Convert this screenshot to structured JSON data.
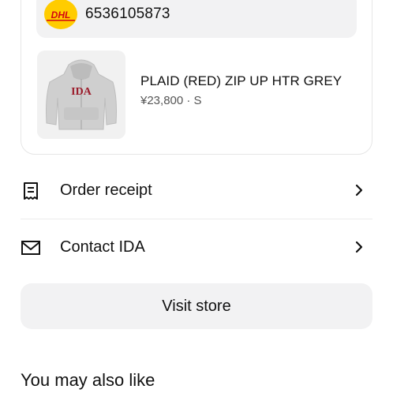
{
  "shipment": {
    "carrier_logo_text": "DHL",
    "tracking_number": "6536105873"
  },
  "product": {
    "image_print": "IDA",
    "name": "PLAID (RED) ZIP UP HTR GREY",
    "meta": "¥23,800 · S"
  },
  "actions": [
    {
      "label": "Order receipt",
      "icon": "receipt-icon"
    },
    {
      "label": "Contact IDA",
      "icon": "mail-icon"
    }
  ],
  "visit_store": {
    "label": "Visit store"
  },
  "recommendations": {
    "title": "You may also like"
  },
  "colors": {
    "dhl_yellow": "#ffcc00",
    "dhl_red": "#d40511",
    "surface_grey": "#f2f2f3",
    "text": "#111111",
    "muted": "#555555"
  }
}
